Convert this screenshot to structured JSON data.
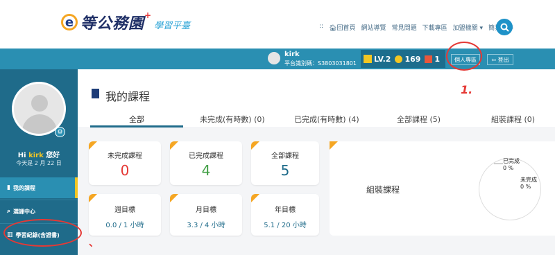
{
  "header": {
    "brand": "等公務園",
    "brand_plus": "+",
    "brand_sub": "學習平臺",
    "nav": [
      "回首頁",
      "網站導覽",
      "常見問題",
      "下載專區",
      "加盟機關 ▾",
      "簡易操作"
    ],
    "nav_prefix": "::",
    "search_icon": "search-icon"
  },
  "userbar": {
    "username": "kirk",
    "platform_id": "平台識別碼：S3803031801",
    "level": "LV.2",
    "coins": "169",
    "gifts": "1",
    "profile_btn": "個人專區",
    "logout_btn": "登出"
  },
  "sidebar": {
    "greeting_prefix": "Hi ",
    "greeting_name": "kirk",
    "greeting_suffix": " 您好",
    "date": "今天是 2 月 22 日",
    "items": [
      {
        "label": "我的課程",
        "icon": "book-icon",
        "active": true
      },
      {
        "label": "選課中心",
        "icon": "search-icon",
        "active": false
      },
      {
        "label": "學習紀錄(含證書)",
        "icon": "chart-icon",
        "active": false
      }
    ]
  },
  "main": {
    "title": "我的課程",
    "tabs": [
      {
        "label": "全部"
      },
      {
        "label": "未完成(有時數) (0)"
      },
      {
        "label": "已完成(有時數) (4)"
      },
      {
        "label": "全部課程 (5)"
      },
      {
        "label": "組裝課程 (0)"
      }
    ],
    "counters": [
      {
        "label": "未完成課程",
        "value": "0",
        "color": "#e53935"
      },
      {
        "label": "已完成課程",
        "value": "4",
        "color": "#43a047"
      },
      {
        "label": "全部課程",
        "value": "5",
        "color": "#1f6b8a"
      }
    ],
    "goals": [
      {
        "label": "週目標",
        "value": "0.0 / 1 小時"
      },
      {
        "label": "月目標",
        "value": "3.3 / 4 小時"
      },
      {
        "label": "年目標",
        "value": "5.1 / 20 小時"
      }
    ],
    "assemble": {
      "label": "組裝課程",
      "done_label": "已完成",
      "done_value": "0 %",
      "undone_label": "未完成",
      "undone_value": "0 %"
    }
  },
  "annotations": {
    "mark_1": "1.",
    "mark_2": "、"
  }
}
